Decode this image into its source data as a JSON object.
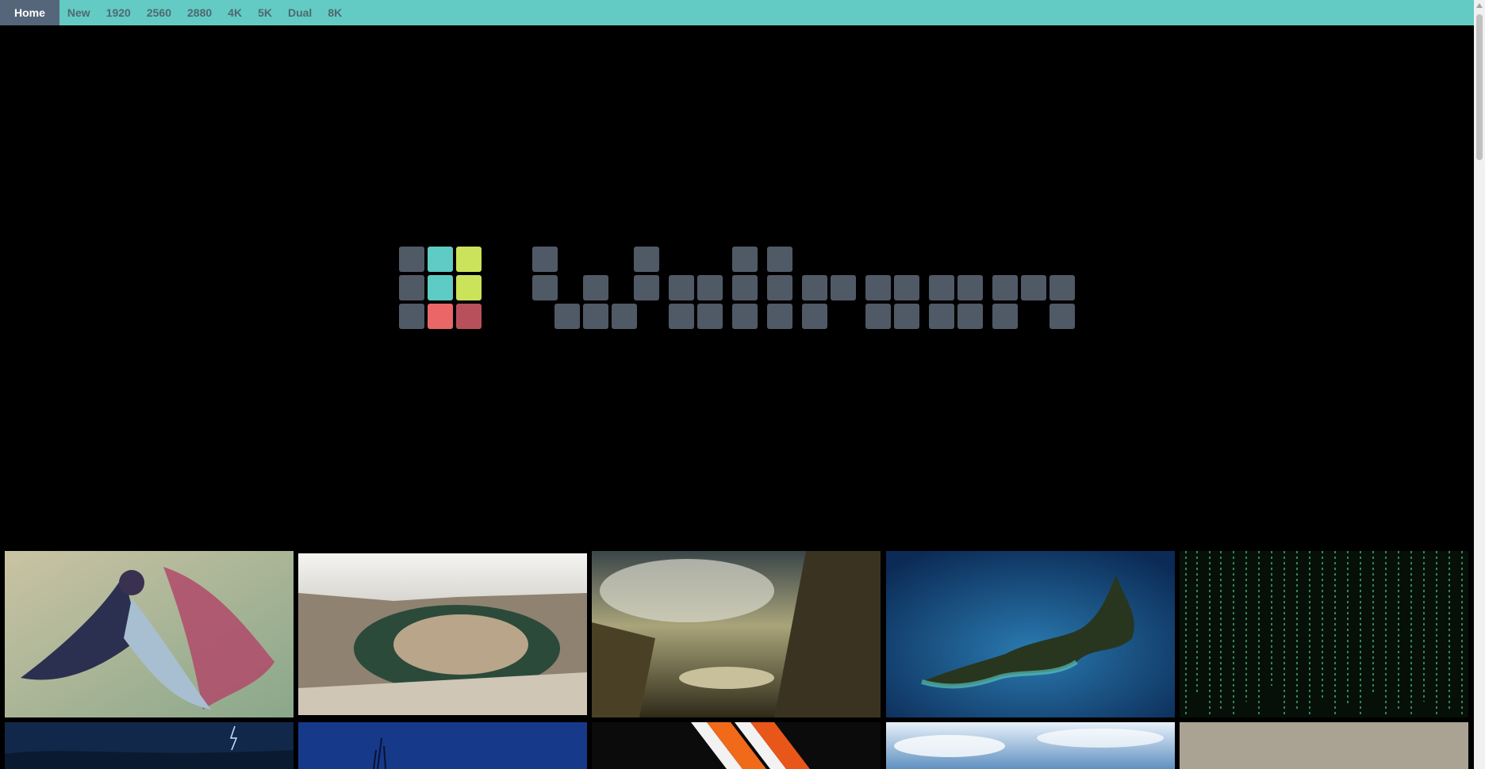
{
  "nav": {
    "items": [
      {
        "label": "Home",
        "active": true
      },
      {
        "label": "New"
      },
      {
        "label": "1920"
      },
      {
        "label": "2560"
      },
      {
        "label": "2880"
      },
      {
        "label": "4K"
      },
      {
        "label": "5K"
      },
      {
        "label": "Dual"
      },
      {
        "label": "8K"
      }
    ]
  },
  "colors": {
    "navbar": "#63cbc4",
    "nav_active": "#55667a",
    "logo_block": "#505a66",
    "logo_teal": "#5ecbc4",
    "logo_lime": "#cbe35b",
    "logo_red": "#ea6767",
    "logo_darkred": "#b8505c"
  },
  "thumbnails": [
    {
      "subject": "bird painting"
    },
    {
      "subject": "canyon bend"
    },
    {
      "subject": "mountain valley painting"
    },
    {
      "subject": "new zealand from space"
    },
    {
      "subject": "green code rain"
    },
    {
      "subject": "lightning sky"
    },
    {
      "subject": "blue plant silhouette"
    },
    {
      "subject": "orange stripes"
    },
    {
      "subject": "sky with clouds"
    },
    {
      "subject": "beige texture"
    }
  ]
}
